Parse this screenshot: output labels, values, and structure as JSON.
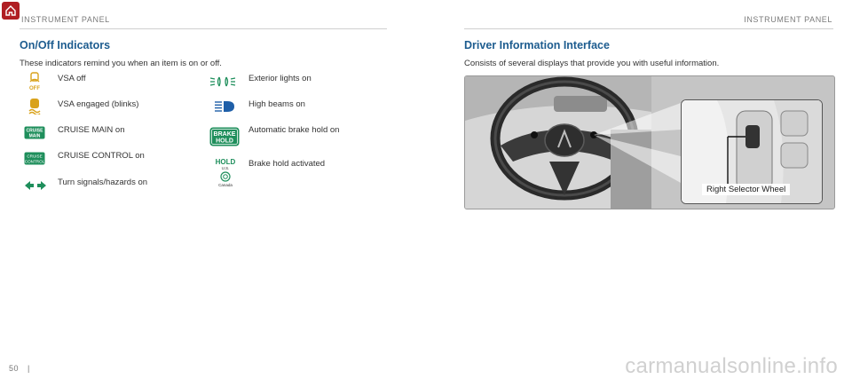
{
  "header": {
    "left": "INSTRUMENT PANEL",
    "right": "INSTRUMENT PANEL"
  },
  "left": {
    "title": "On/Off Indicators",
    "subtitle": "These indicators remind you when an item is on or off.",
    "indicators": [
      {
        "label": "VSA off",
        "icon": "vsa-off-icon",
        "icon_text": "OFF"
      },
      {
        "label": "VSA engaged (blinks)",
        "icon": "vsa-engaged-icon"
      },
      {
        "label": "CRUISE MAIN on",
        "icon": "cruise-main-icon",
        "icon_text_1": "CRUISE",
        "icon_text_2": "MAIN"
      },
      {
        "label": "CRUISE CONTROL on",
        "icon": "cruise-control-icon",
        "icon_text_1": "CRUISE",
        "icon_text_2": "CONTROL"
      },
      {
        "label": "Turn signals/hazards on",
        "icon": "turn-signal-icon"
      },
      {
        "label": "Exterior lights on",
        "icon": "exterior-lights-icon"
      },
      {
        "label": "High beams on",
        "icon": "high-beam-icon"
      },
      {
        "label": "Automatic brake hold on",
        "icon": "brake-hold-icon",
        "icon_text_1": "BRAKE",
        "icon_text_2": "HOLD"
      },
      {
        "label": "Brake hold activated",
        "icon": "hold-activated-icon",
        "icon_text_1": "HOLD",
        "icon_text_us": "U.S.",
        "icon_text_canada": "Canada"
      }
    ]
  },
  "right": {
    "title": "Driver Information Interface",
    "subtitle": "Consists of several displays that provide you with useful information.",
    "callout": "Right Selector Wheel"
  },
  "footer": {
    "page": "50",
    "separator": "|"
  },
  "watermark": "carmanualsonline.info",
  "colors": {
    "title": "#1d5c8f",
    "indicator_amber": "#d9a21b",
    "indicator_green": "#1f8f5c",
    "indicator_blue": "#1f5fa8",
    "home_red": "#b01e23"
  }
}
